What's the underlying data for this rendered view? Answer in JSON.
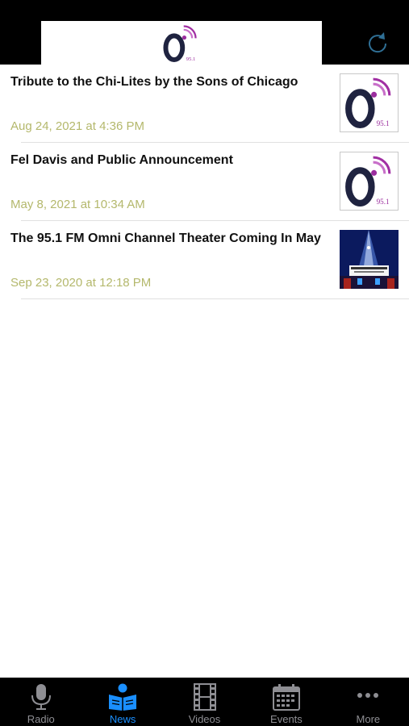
{
  "colors": {
    "accent": "#1a8fff",
    "date_text": "#b4b86c",
    "tab_inactive": "#8e8e93",
    "logo_purple": "#9b2d9e",
    "logo_navy": "#1f2340"
  },
  "header": {
    "logo_number": "95.1",
    "refresh_icon": "refresh-icon"
  },
  "articles": [
    {
      "title": "Tribute to the Chi-Lites by the Sons of Chicago",
      "date": "Aug 24, 2021 at 4:36 PM",
      "thumb": "logo"
    },
    {
      "title": "Fel Davis and Public Announcement",
      "date": "May 8, 2021 at 10:34 AM",
      "thumb": "logo"
    },
    {
      "title": "The 95.1 FM Omni Channel Theater Coming In May",
      "date": "Sep 23, 2020 at 12:18 PM",
      "thumb": "theater"
    }
  ],
  "tabs": [
    {
      "label": "Radio",
      "icon": "microphone-icon",
      "active": false
    },
    {
      "label": "News",
      "icon": "newspaper-reader-icon",
      "active": true
    },
    {
      "label": "Videos",
      "icon": "film-strip-icon",
      "active": false
    },
    {
      "label": "Events",
      "icon": "calendar-icon",
      "active": false
    },
    {
      "label": "More",
      "icon": "more-dots-icon",
      "active": false
    }
  ]
}
